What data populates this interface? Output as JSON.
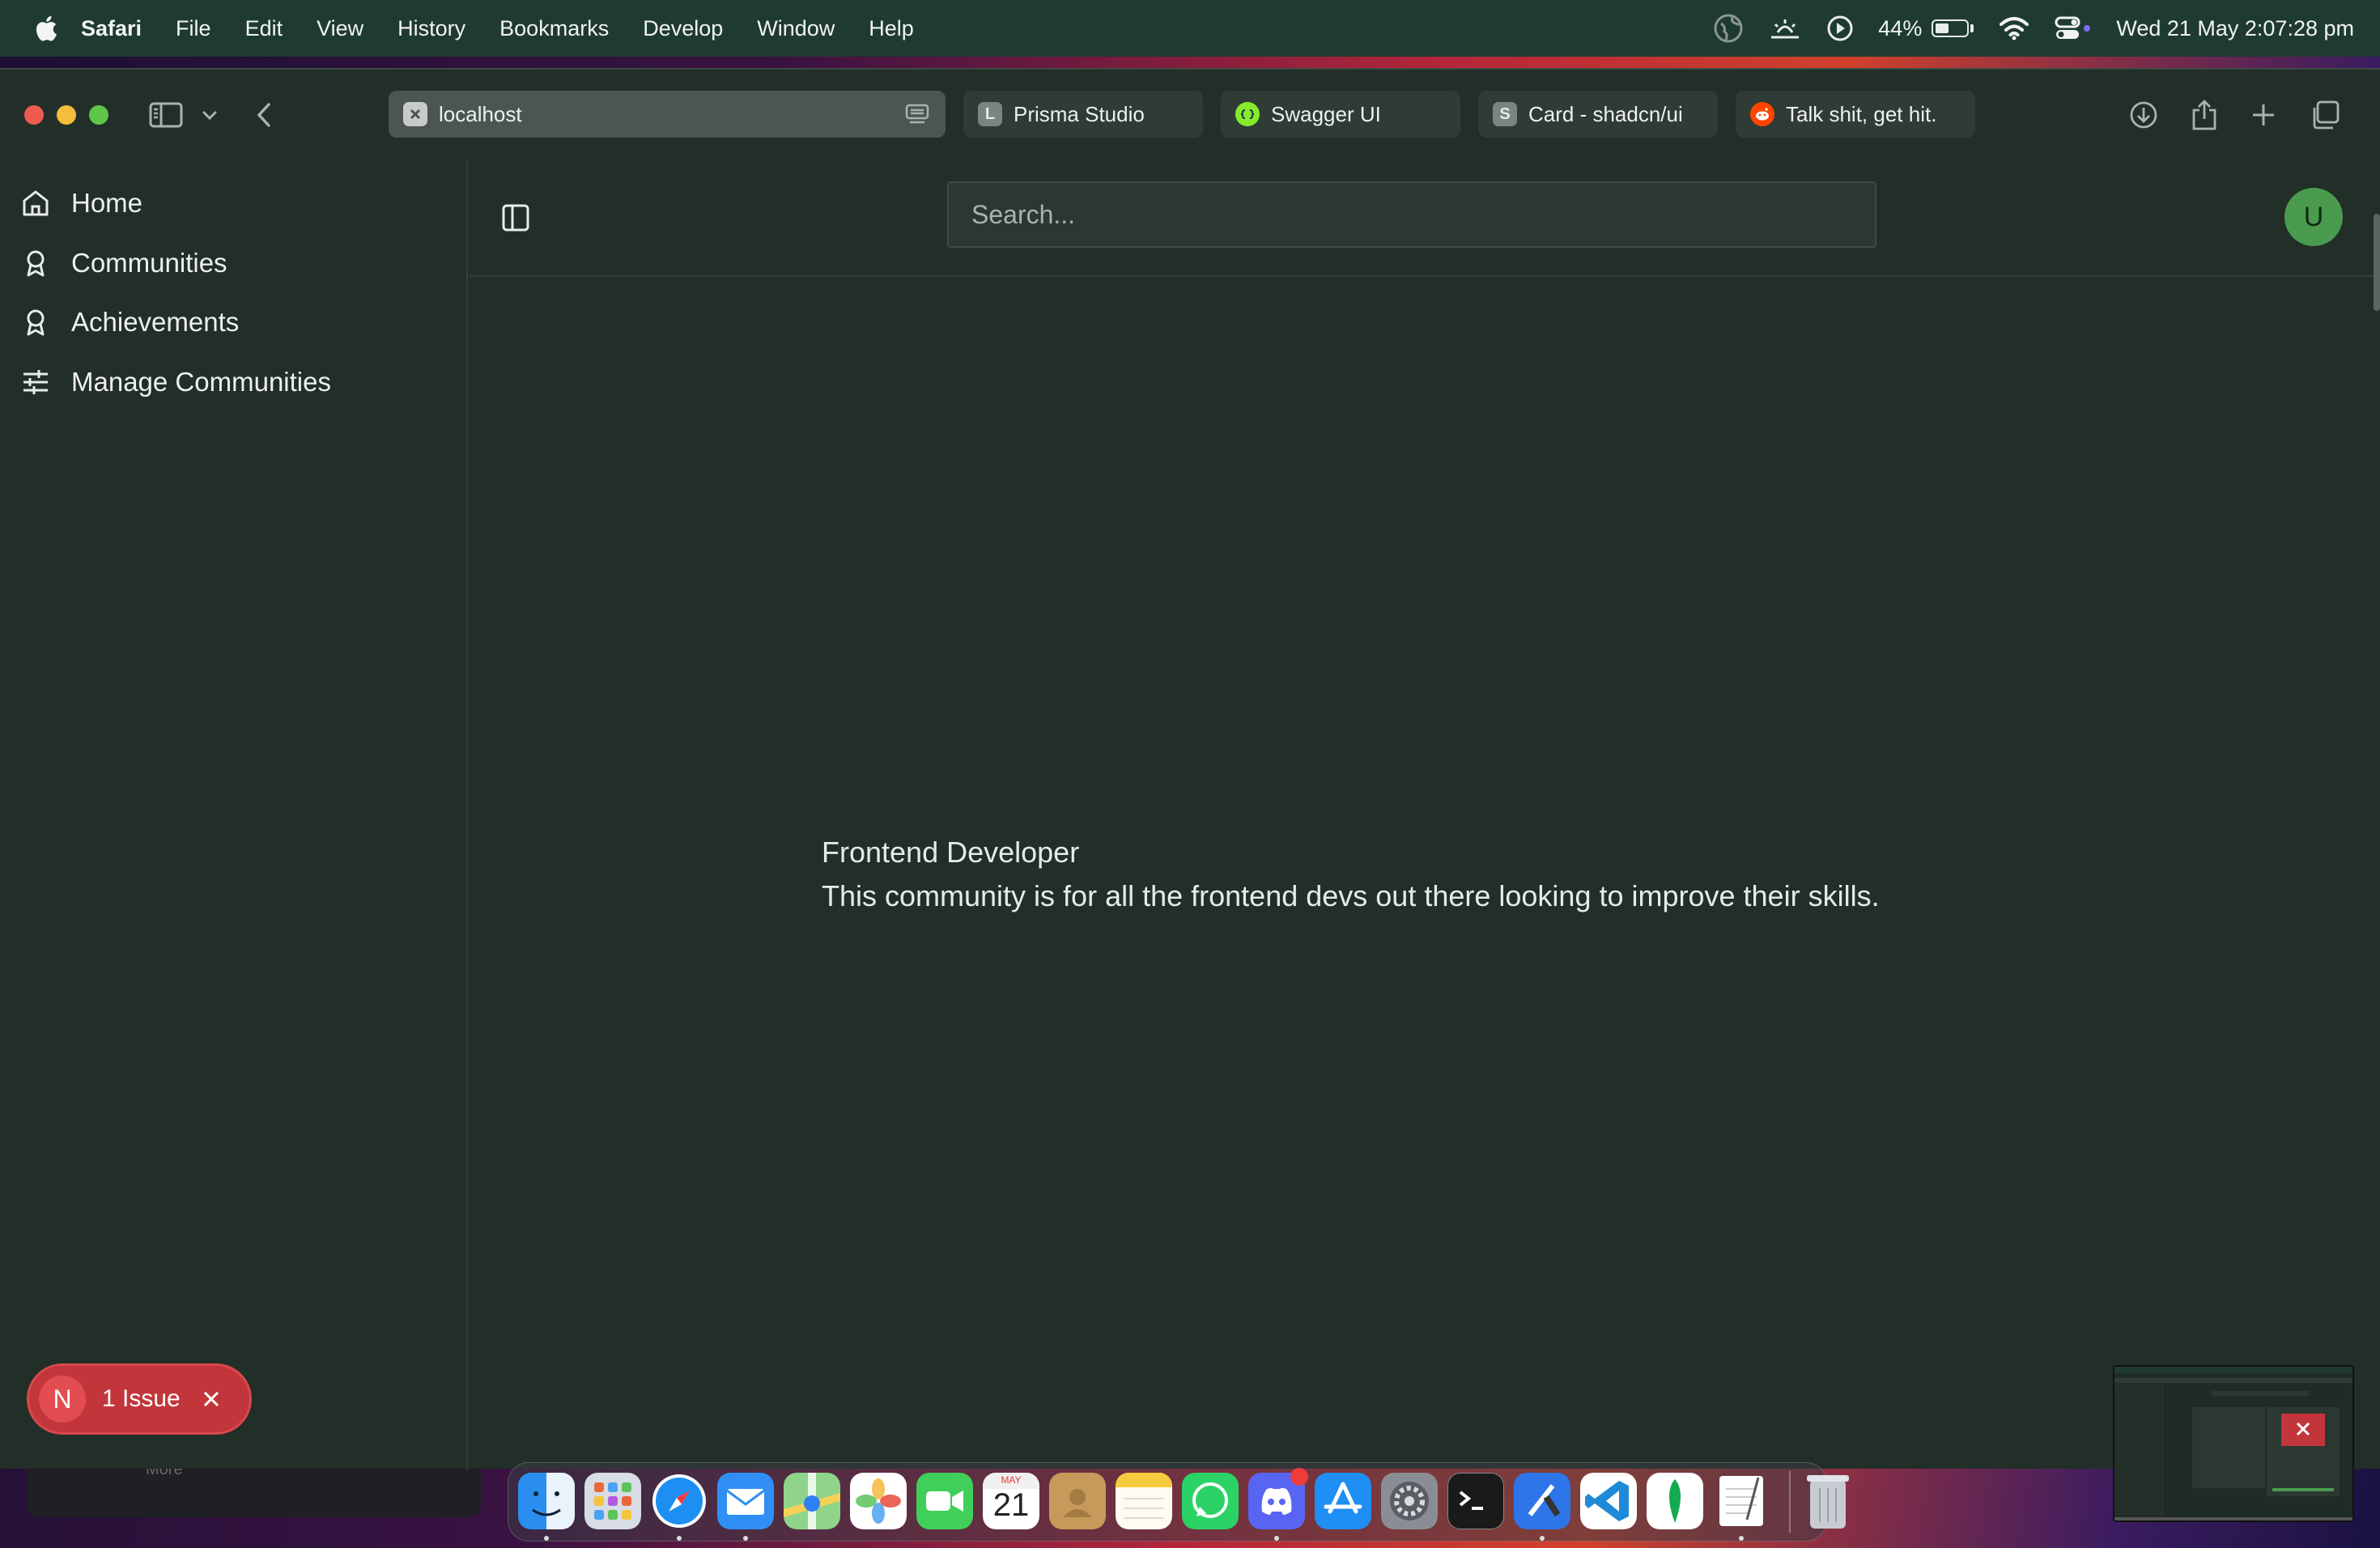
{
  "menubar": {
    "app_name": "Safari",
    "items": [
      "File",
      "Edit",
      "View",
      "History",
      "Bookmarks",
      "Develop",
      "Window",
      "Help"
    ],
    "battery_percent": "44%",
    "battery_level": 0.44,
    "datetime": "Wed 21 May  2:07:28 pm"
  },
  "tabs": [
    {
      "label": "localhost",
      "favicon": "x",
      "active": true
    },
    {
      "label": "Prisma Studio",
      "favicon": "L",
      "active": false
    },
    {
      "label": "Swagger UI",
      "favicon": "swagger-icon",
      "active": false
    },
    {
      "label": "Card - shadcn/ui",
      "favicon": "S",
      "active": false
    },
    {
      "label": "Talk shit, get hit.",
      "favicon": "reddit-icon",
      "active": false
    }
  ],
  "sidebar": {
    "items": [
      {
        "label": "Home",
        "icon": "home-icon"
      },
      {
        "label": "Communities",
        "icon": "award-icon"
      },
      {
        "label": "Achievements",
        "icon": "award-icon"
      },
      {
        "label": "Manage Communities",
        "icon": "sliders-icon"
      }
    ]
  },
  "header": {
    "search_placeholder": "Search...",
    "avatar_initial": "U"
  },
  "community": {
    "name": "Frontend Developer",
    "description": "This community is for all the frontend devs out there looking to improve their skills."
  },
  "issue_badge": {
    "initial": "N",
    "label": "1 Issue"
  },
  "background_window": {
    "text": "More"
  },
  "dock": {
    "apps": [
      "finder-icon",
      "launchpad-icon",
      "safari-icon",
      "mail-icon",
      "maps-icon",
      "photos-icon",
      "facetime-icon",
      "calendar-icon",
      "contacts-icon",
      "notes-icon",
      "whatsapp-icon",
      "discord-icon",
      "app-store-icon",
      "system-settings-icon",
      "terminal-icon",
      "xcode-icon",
      "vscode-icon",
      "mongodb-compass-icon",
      "textedit-icon",
      "trash-icon"
    ],
    "calendar_month": "MAY",
    "calendar_day": "21"
  },
  "colors": {
    "menubar_bg": "#1e3a33",
    "window_bg": "#222e28",
    "accent_green": "#4a9b4e",
    "issue_red": "#c2363b"
  }
}
